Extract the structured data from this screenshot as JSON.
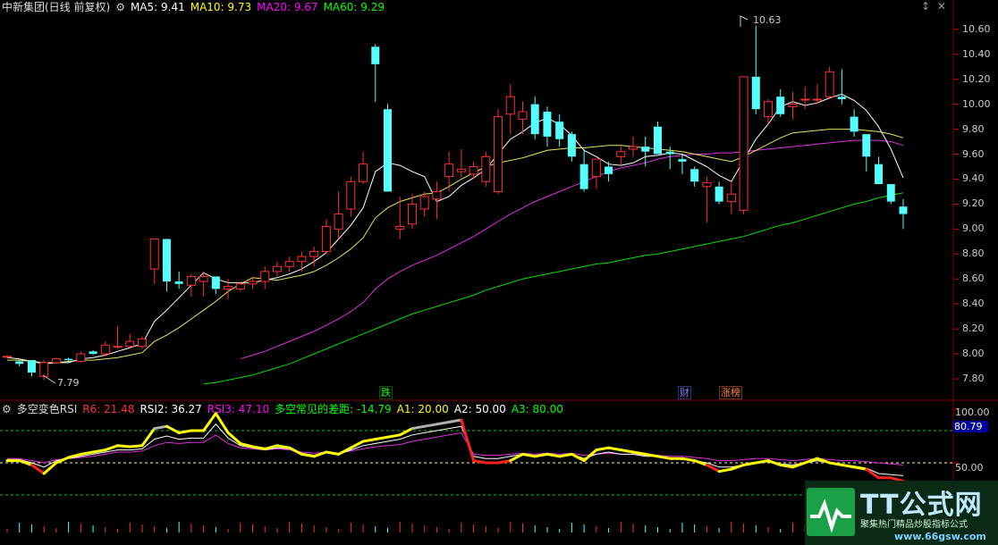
{
  "header": {
    "stock": "中新集团(日线 前复权)",
    "ma": [
      {
        "label": "MA5: 9.41",
        "color": "#ffffff"
      },
      {
        "label": "MA10: 9.73",
        "color": "#ffff00"
      },
      {
        "label": "MA20: 9.67",
        "color": "#ff00ff"
      },
      {
        "label": "MA60: 9.29",
        "color": "#00ff00"
      }
    ]
  },
  "indicator": {
    "name": "多空变色RSI",
    "items": [
      {
        "label": "R6: 21.48",
        "color": "#ff3030"
      },
      {
        "label": "RSI2: 36.27",
        "color": "#ffffff"
      },
      {
        "label": "RSI3: 47.10",
        "color": "#ff00ff"
      },
      {
        "label": "多空常见的差距: -14.79",
        "color": "#00ff00"
      },
      {
        "label": "A1: 20.00",
        "color": "#ffff00"
      },
      {
        "label": "A2: 50.00",
        "color": "#ffffff"
      },
      {
        "label": "A3: 80.00",
        "color": "#00ff00"
      }
    ],
    "current": "80.79",
    "axis": [
      "100.00",
      "50.00"
    ]
  },
  "price_axis": [
    "10.60",
    "10.40",
    "10.20",
    "10.00",
    "9.80",
    "9.60",
    "9.40",
    "9.20",
    "9.00",
    "8.80",
    "8.60",
    "8.40",
    "8.20",
    "8.00",
    "7.80"
  ],
  "annotations": {
    "high": "10.63",
    "low": "7.79"
  },
  "events": [
    {
      "label": "跌",
      "color": "#00ff00"
    },
    {
      "label": "财",
      "color": "#8080ff"
    },
    {
      "label": "涨榜",
      "color": "#ff8040"
    }
  ],
  "watermark": {
    "brand": "TT公式网",
    "tag": "聚集热门精品炒股指标公式",
    "url": "www.66gsw.com"
  },
  "colors": {
    "up": "#ff3030",
    "down": "#54ffff",
    "grid": "#800000"
  },
  "chart_data": {
    "type": "candlestick",
    "candles": [
      [
        7.98,
        7.99,
        7.97,
        7.98
      ],
      [
        7.94,
        7.95,
        7.9,
        7.92
      ],
      [
        7.95,
        7.95,
        7.82,
        7.85
      ],
      [
        7.82,
        7.95,
        7.79,
        7.93
      ],
      [
        7.93,
        7.97,
        7.92,
        7.96
      ],
      [
        7.96,
        7.97,
        7.93,
        7.95
      ],
      [
        7.94,
        8.02,
        7.93,
        8.0
      ],
      [
        8.02,
        8.03,
        7.99,
        8.0
      ],
      [
        8.0,
        8.1,
        7.98,
        8.07
      ],
      [
        8.06,
        8.22,
        8.04,
        8.06
      ],
      [
        8.06,
        8.16,
        8.05,
        8.1
      ],
      [
        8.06,
        8.14,
        8.04,
        8.12
      ],
      [
        8.68,
        8.92,
        8.56,
        8.92
      ],
      [
        8.92,
        8.92,
        8.5,
        8.58
      ],
      [
        8.58,
        8.66,
        8.52,
        8.56
      ],
      [
        8.55,
        8.64,
        8.46,
        8.62
      ],
      [
        8.58,
        8.66,
        8.46,
        8.62
      ],
      [
        8.62,
        8.62,
        8.48,
        8.52
      ],
      [
        8.52,
        8.6,
        8.44,
        8.54
      ],
      [
        8.52,
        8.58,
        8.5,
        8.56
      ],
      [
        8.56,
        8.62,
        8.52,
        8.58
      ],
      [
        8.58,
        8.7,
        8.52,
        8.66
      ],
      [
        8.66,
        8.74,
        8.62,
        8.7
      ],
      [
        8.7,
        8.78,
        8.66,
        8.74
      ],
      [
        8.74,
        8.82,
        8.66,
        8.78
      ],
      [
        8.78,
        8.86,
        8.7,
        8.82
      ],
      [
        8.82,
        9.08,
        8.8,
        9.02
      ],
      [
        9.0,
        9.3,
        8.92,
        9.12
      ],
      [
        9.16,
        9.42,
        9.1,
        9.38
      ],
      [
        9.38,
        9.62,
        9.36,
        9.52
      ],
      [
        10.46,
        10.48,
        10.02,
        10.32
      ],
      [
        9.96,
        10.0,
        9.3,
        9.3
      ],
      [
        9.0,
        9.26,
        8.92,
        9.02
      ],
      [
        9.04,
        9.28,
        9.0,
        9.2
      ],
      [
        9.16,
        9.3,
        9.1,
        9.26
      ],
      [
        9.24,
        9.38,
        9.08,
        9.3
      ],
      [
        9.42,
        9.62,
        9.3,
        9.52
      ],
      [
        9.46,
        9.64,
        9.42,
        9.48
      ],
      [
        9.44,
        9.54,
        9.4,
        9.5
      ],
      [
        9.38,
        9.62,
        9.34,
        9.58
      ],
      [
        9.3,
        9.96,
        9.28,
        9.9
      ],
      [
        9.92,
        10.16,
        9.76,
        10.06
      ],
      [
        9.88,
        10.02,
        9.76,
        9.94
      ],
      [
        10.0,
        10.06,
        9.72,
        9.76
      ],
      [
        9.94,
        9.98,
        9.66,
        9.74
      ],
      [
        9.86,
        9.92,
        9.66,
        9.72
      ],
      [
        9.76,
        9.78,
        9.54,
        9.58
      ],
      [
        9.52,
        9.64,
        9.3,
        9.32
      ],
      [
        9.42,
        9.56,
        9.32,
        9.56
      ],
      [
        9.5,
        9.54,
        9.38,
        9.44
      ],
      [
        9.58,
        9.66,
        9.52,
        9.62
      ],
      [
        9.64,
        9.74,
        9.58,
        9.66
      ],
      [
        9.66,
        9.74,
        9.5,
        9.62
      ],
      [
        9.82,
        9.86,
        9.6,
        9.6
      ],
      [
        9.62,
        9.66,
        9.48,
        9.6
      ],
      [
        9.56,
        9.6,
        9.44,
        9.54
      ],
      [
        9.48,
        9.5,
        9.34,
        9.38
      ],
      [
        9.34,
        9.42,
        9.05,
        9.37
      ],
      [
        9.34,
        9.38,
        9.2,
        9.22
      ],
      [
        9.22,
        9.38,
        9.12,
        9.28
      ],
      [
        9.15,
        10.22,
        9.12,
        10.22
      ],
      [
        10.22,
        10.63,
        9.92,
        9.96
      ],
      [
        9.9,
        10.04,
        9.84,
        10.02
      ],
      [
        10.06,
        10.12,
        9.9,
        9.92
      ],
      [
        9.98,
        10.1,
        9.88,
        10.0
      ],
      [
        10.04,
        10.14,
        9.96,
        10.04
      ],
      [
        10.04,
        10.16,
        10.0,
        10.04
      ],
      [
        10.06,
        10.3,
        10.04,
        10.26
      ],
      [
        10.06,
        10.28,
        10.0,
        10.04
      ],
      [
        9.9,
        9.96,
        9.74,
        9.78
      ],
      [
        9.76,
        9.76,
        9.46,
        9.58
      ],
      [
        9.52,
        9.58,
        9.36,
        9.36
      ],
      [
        9.36,
        9.36,
        9.2,
        9.22
      ],
      [
        9.18,
        9.24,
        9.0,
        9.12
      ]
    ],
    "price_range": [
      7.7,
      10.72
    ],
    "ma5": [
      7.97,
      7.96,
      7.94,
      7.92,
      7.93,
      7.93,
      7.96,
      7.97,
      7.99,
      8.02,
      8.05,
      8.08,
      8.26,
      8.35,
      8.45,
      8.55,
      8.65,
      8.6,
      8.57,
      8.57,
      8.57,
      8.59,
      8.61,
      8.64,
      8.68,
      8.74,
      8.81,
      8.92,
      9.03,
      9.17,
      9.46,
      9.53,
      9.51,
      9.46,
      9.42,
      9.22,
      9.26,
      9.35,
      9.41,
      9.48,
      9.6,
      9.72,
      9.78,
      9.85,
      9.89,
      9.84,
      9.75,
      9.63,
      9.58,
      9.52,
      9.51,
      9.53,
      9.58,
      9.59,
      9.61,
      9.6,
      9.55,
      9.5,
      9.43,
      9.38,
      9.55,
      9.72,
      9.84,
      9.98,
      10.02,
      9.99,
      10.01,
      10.05,
      10.08,
      10.03,
      9.95,
      9.82,
      9.64,
      9.41
    ],
    "ma10": [
      7.95,
      7.95,
      7.94,
      7.93,
      7.93,
      7.94,
      7.95,
      7.95,
      7.96,
      7.97,
      7.99,
      8.01,
      8.1,
      8.15,
      8.21,
      8.28,
      8.35,
      8.42,
      8.5,
      8.56,
      8.61,
      8.6,
      8.59,
      8.61,
      8.63,
      8.66,
      8.71,
      8.77,
      8.84,
      8.93,
      9.09,
      9.17,
      9.22,
      9.25,
      9.28,
      9.29,
      9.34,
      9.4,
      9.45,
      9.5,
      9.53,
      9.55,
      9.57,
      9.6,
      9.63,
      9.64,
      9.65,
      9.65,
      9.66,
      9.67,
      9.67,
      9.66,
      9.65,
      9.64,
      9.63,
      9.62,
      9.6,
      9.58,
      9.56,
      9.54,
      9.58,
      9.63,
      9.68,
      9.73,
      9.77,
      9.78,
      9.79,
      9.8,
      9.8,
      9.8,
      9.79,
      9.78,
      9.76,
      9.73
    ],
    "ma20": [
      null,
      null,
      null,
      null,
      null,
      null,
      null,
      null,
      null,
      null,
      null,
      null,
      null,
      null,
      null,
      null,
      null,
      null,
      null,
      7.96,
      7.99,
      8.02,
      8.06,
      8.1,
      8.14,
      8.18,
      8.23,
      8.28,
      8.34,
      8.41,
      8.52,
      8.6,
      8.66,
      8.71,
      8.75,
      8.79,
      8.84,
      8.89,
      8.94,
      9.0,
      9.06,
      9.12,
      9.17,
      9.22,
      9.26,
      9.3,
      9.34,
      9.38,
      9.42,
      9.46,
      9.49,
      9.51,
      9.53,
      9.56,
      9.58,
      9.59,
      9.6,
      9.6,
      9.61,
      9.61,
      9.62,
      9.63,
      9.64,
      9.65,
      9.66,
      9.67,
      9.68,
      9.69,
      9.7,
      9.71,
      9.71,
      9.71,
      9.7,
      9.67
    ],
    "ma60": [
      null,
      null,
      null,
      null,
      null,
      null,
      null,
      null,
      null,
      null,
      null,
      null,
      null,
      null,
      null,
      null,
      7.76,
      7.77,
      7.79,
      7.81,
      7.83,
      7.86,
      7.89,
      7.92,
      7.96,
      8.0,
      8.04,
      8.08,
      8.12,
      8.16,
      8.2,
      8.24,
      8.28,
      8.32,
      8.35,
      8.38,
      8.41,
      8.44,
      8.47,
      8.51,
      8.54,
      8.57,
      8.6,
      8.62,
      8.64,
      8.66,
      8.68,
      8.7,
      8.72,
      8.73,
      8.75,
      8.77,
      8.79,
      8.8,
      8.82,
      8.84,
      8.86,
      8.88,
      8.9,
      8.92,
      8.94,
      8.97,
      9.0,
      9.03,
      9.05,
      9.08,
      9.11,
      9.14,
      9.17,
      9.2,
      9.22,
      9.25,
      9.27,
      9.29
    ],
    "rsi1": [
      52,
      52,
      48,
      40,
      50,
      55,
      58,
      60,
      62,
      66,
      65,
      66,
      82,
      84,
      78,
      80,
      80,
      96,
      78,
      68,
      65,
      63,
      66,
      64,
      58,
      56,
      60,
      58,
      64,
      70,
      72,
      74,
      76,
      82,
      84,
      86,
      88,
      90,
      52,
      50,
      50,
      52,
      58,
      56,
      58,
      56,
      58,
      52,
      62,
      64,
      62,
      60,
      58,
      56,
      54,
      54,
      52,
      48,
      42,
      44,
      48,
      50,
      52,
      48,
      46,
      50,
      54,
      50,
      48,
      46,
      44,
      36,
      36,
      33
    ],
    "rsi2": [
      53,
      53,
      50,
      46,
      52,
      54,
      56,
      58,
      60,
      62,
      62,
      63,
      72,
      75,
      72,
      73,
      73,
      86,
      73,
      66,
      64,
      62,
      64,
      63,
      59,
      57,
      60,
      58,
      62,
      66,
      68,
      70,
      72,
      76,
      78,
      80,
      82,
      84,
      56,
      54,
      54,
      56,
      58,
      56,
      58,
      56,
      58,
      54,
      58,
      60,
      58,
      58,
      56,
      56,
      54,
      53,
      52,
      50,
      46,
      46,
      48,
      50,
      51,
      49,
      48,
      50,
      52,
      50,
      48,
      47,
      45,
      40,
      39,
      38
    ],
    "rsi3": [
      54,
      54,
      52,
      50,
      53,
      54,
      55,
      56,
      58,
      60,
      60,
      61,
      66,
      69,
      68,
      69,
      69,
      76,
      68,
      64,
      63,
      62,
      63,
      62,
      60,
      59,
      60,
      59,
      61,
      63,
      65,
      66,
      67,
      70,
      72,
      74,
      76,
      78,
      58,
      57,
      57,
      58,
      59,
      58,
      59,
      58,
      59,
      57,
      58,
      59,
      58,
      58,
      57,
      57,
      56,
      56,
      55,
      54,
      52,
      52,
      53,
      54,
      54,
      53,
      52,
      53,
      54,
      53,
      52,
      52,
      51,
      50,
      49,
      48
    ],
    "rsi_range": [
      0,
      105
    ]
  }
}
